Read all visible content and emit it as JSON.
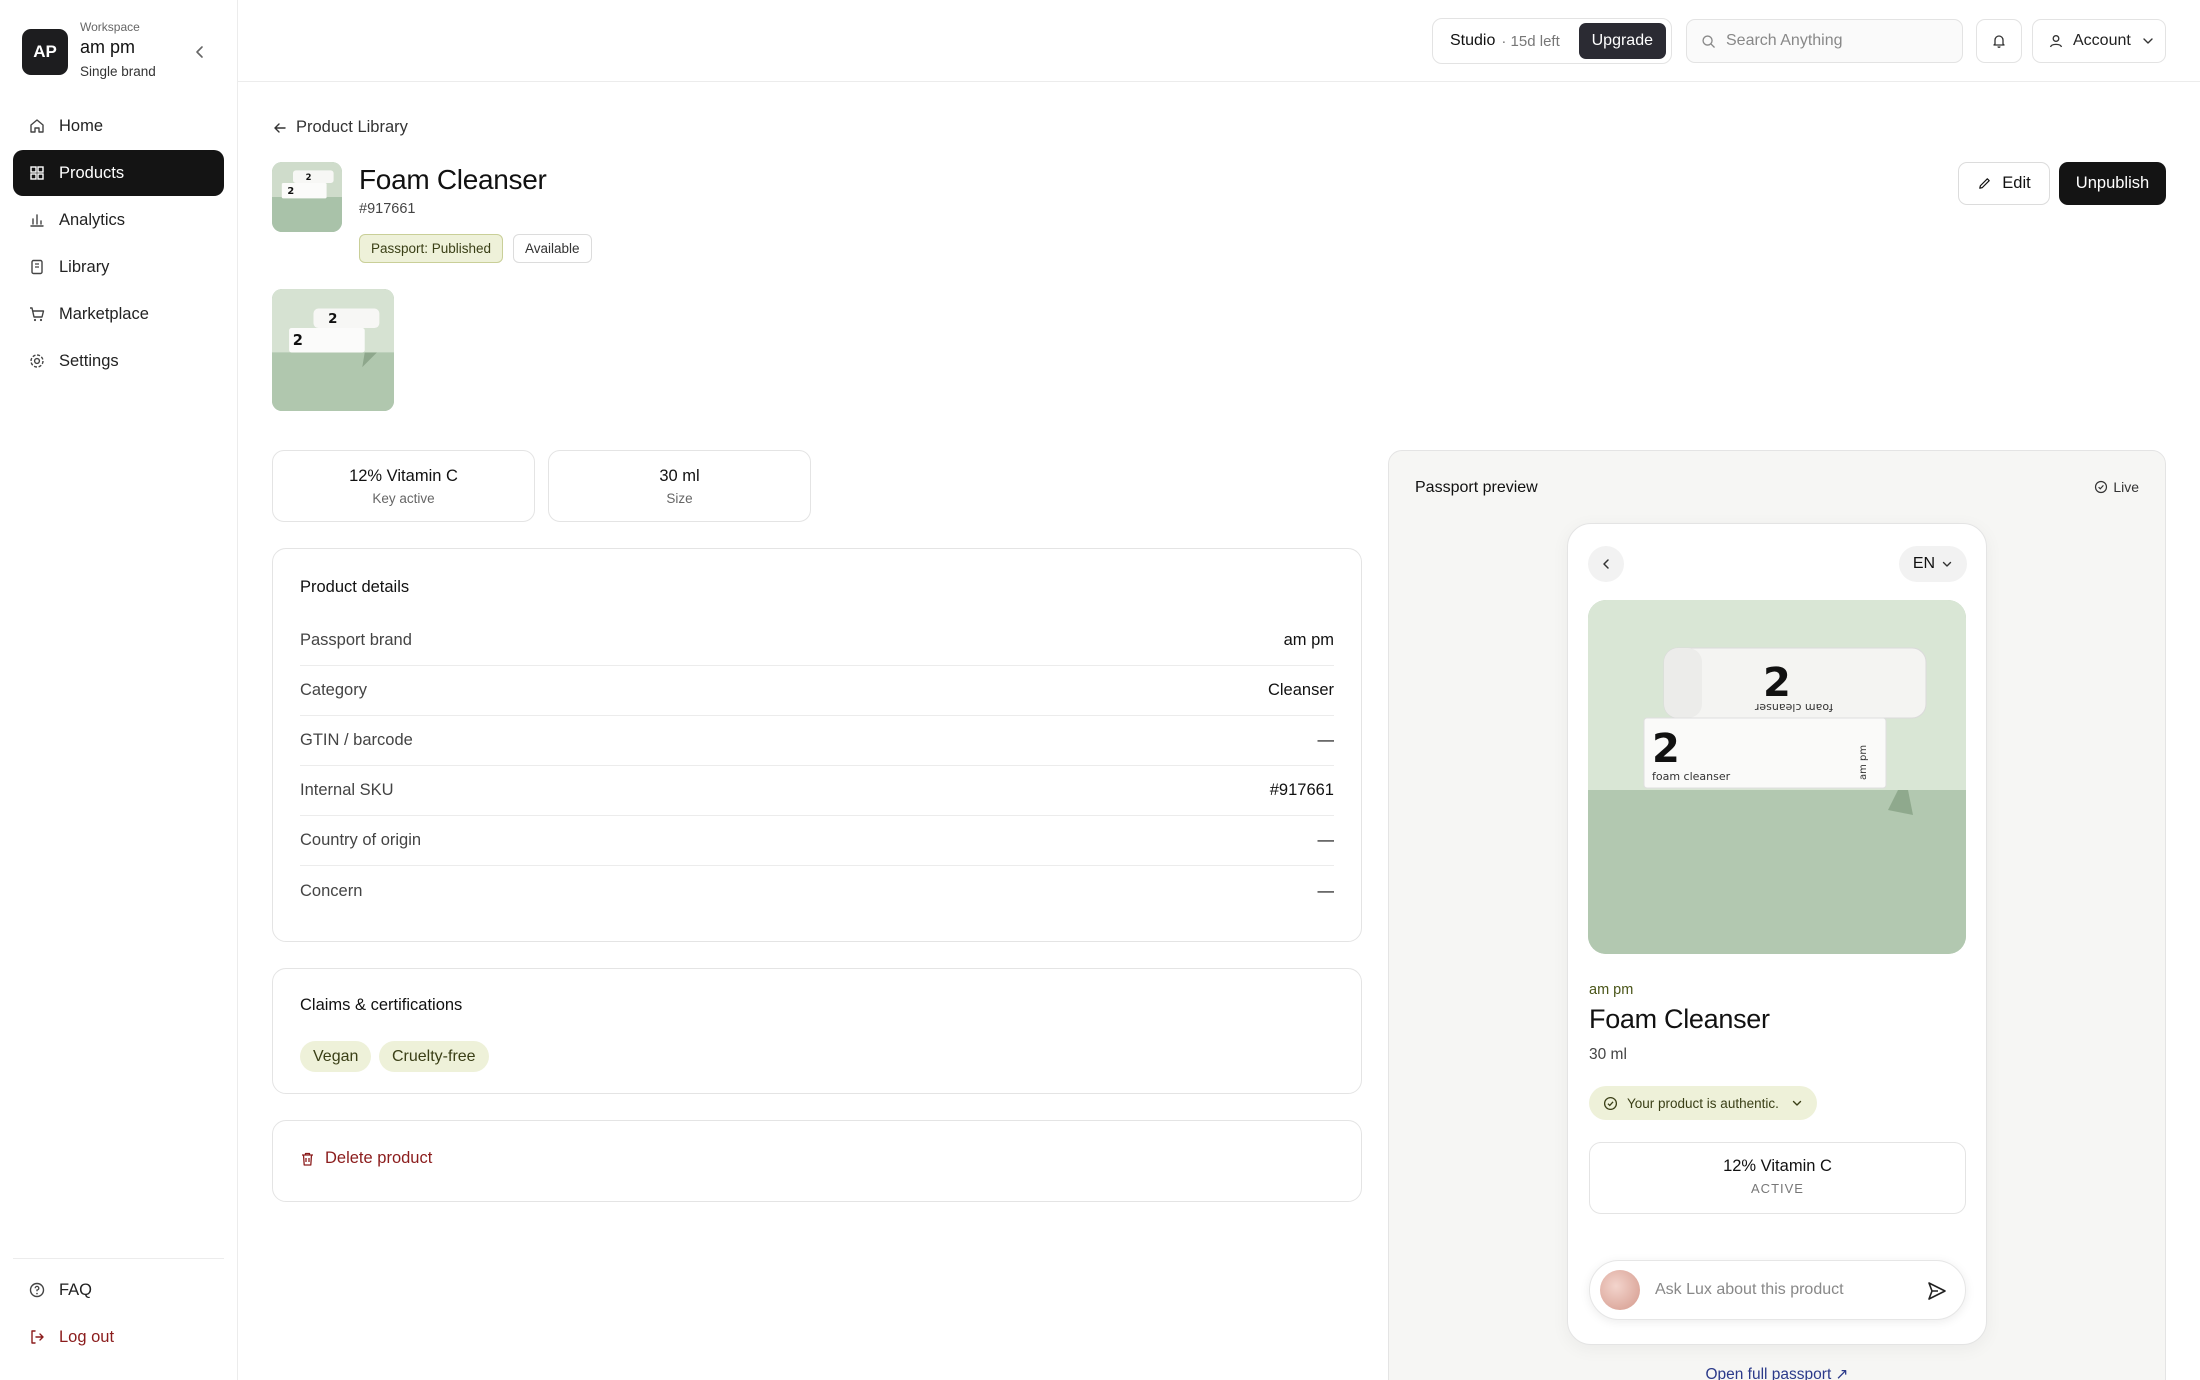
{
  "workspace": {
    "label": "Workspace",
    "avatar": "AP",
    "name": "am pm",
    "plan": "Single brand"
  },
  "sidebar": {
    "items": [
      {
        "label": "Home",
        "icon": "home-icon"
      },
      {
        "label": "Products",
        "icon": "grid-icon",
        "active": true
      },
      {
        "label": "Analytics",
        "icon": "bar-chart-icon"
      },
      {
        "label": "Library",
        "icon": "book-icon"
      },
      {
        "label": "Marketplace",
        "icon": "cart-icon"
      },
      {
        "label": "Settings",
        "icon": "gear-icon"
      }
    ],
    "footer": [
      {
        "label": "FAQ",
        "icon": "help-circle-icon"
      },
      {
        "label": "Log out",
        "icon": "logout-icon"
      }
    ]
  },
  "topbar": {
    "plan_name": "Studio",
    "plan_days": "· 15d left",
    "upgrade_label": "Upgrade",
    "search_placeholder": "Search Anything",
    "account_label": "Account"
  },
  "product": {
    "back_label": "Product Library",
    "title": "Foam Cleanser",
    "sku": "#917661",
    "badges": [
      "Passport: Published",
      "Available"
    ],
    "edit_label": "Edit",
    "unpublish_label": "Unpublish",
    "stats": [
      {
        "value": "12% Vitamin C",
        "label": "Key active"
      },
      {
        "value": "30 ml",
        "label": "Size"
      }
    ]
  },
  "details": {
    "title": "Product details",
    "rows": [
      {
        "key": "Passport brand",
        "value": "am pm"
      },
      {
        "key": "Category",
        "value": "Cleanser"
      },
      {
        "key": "GTIN / barcode",
        "value": "—"
      },
      {
        "key": "Internal SKU",
        "value": "#917661"
      },
      {
        "key": "Country of origin",
        "value": "—"
      },
      {
        "key": "Concern",
        "value": "—"
      }
    ]
  },
  "claims": {
    "title": "Claims & certifications",
    "chips": [
      "Vegan",
      "Cruelty-free"
    ]
  },
  "danger": {
    "delete_label": "Delete product"
  },
  "preview": {
    "title": "Passport preview",
    "status": "Live",
    "language": "EN",
    "brand": "am pm",
    "product_title": "Foam Cleanser",
    "size": "30 ml",
    "authentic_label": "Your product is authentic.",
    "active_value": "12% Vitamin C",
    "active_label": "ACTIVE",
    "ask_placeholder": "Ask Lux about this product",
    "open_label": "Open full passport ↗"
  },
  "colors": {
    "accent_dark": "#141414",
    "badge_green_bg": "#eef1d9",
    "danger": "#8b1c1c",
    "link": "#2b3a8a"
  }
}
